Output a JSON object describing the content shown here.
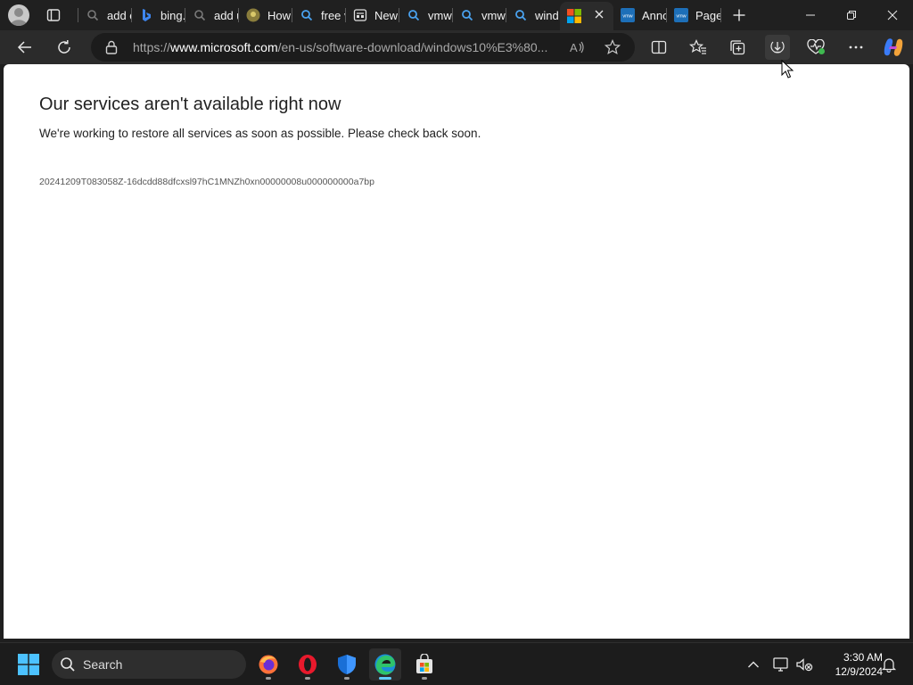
{
  "browser": {
    "tabs": [
      {
        "title": "add e",
        "icon": "search-icon"
      },
      {
        "title": "bing.",
        "icon": "bing-icon"
      },
      {
        "title": "add u",
        "icon": "search-icon"
      },
      {
        "title": "How",
        "icon": "page-icon"
      },
      {
        "title": "free v",
        "icon": "search-icon"
      },
      {
        "title": "New",
        "icon": "newtab-icon"
      },
      {
        "title": "vmwa",
        "icon": "search-icon"
      },
      {
        "title": "vmwa",
        "icon": "search-icon"
      },
      {
        "title": "wind",
        "icon": "search-icon"
      },
      {
        "title": "",
        "icon": "microsoft-logo-icon",
        "active": true
      },
      {
        "title": "Anno",
        "icon": "vmware-icon"
      },
      {
        "title": "Page",
        "icon": "vmware-icon"
      }
    ],
    "address_bar": {
      "url_prefix": "https://",
      "url_domain": "www.microsoft.com",
      "url_path": "/en-us/software-download/windows10%E3%80..."
    }
  },
  "page": {
    "error_title": "Our services aren't available right now",
    "error_message": "We're working to restore all services as soon as possible. Please check back soon.",
    "reference_code": "20241209T083058Z-16dcdd88dfcxsl97hC1MNZh0xn00000008u000000000a7bp"
  },
  "taskbar": {
    "search_label": "Search",
    "apps": [
      "firefox-icon",
      "opera-icon",
      "defender-icon",
      "edge-icon",
      "store-icon"
    ],
    "time": "3:30 AM",
    "date": "12/9/2024"
  },
  "colors": {
    "tab_strip": "#202020",
    "toolbar": "#2b2b2b",
    "page_bg": "#ffffff",
    "taskbar": "#1c1c1c",
    "accent": "#60cdff"
  }
}
